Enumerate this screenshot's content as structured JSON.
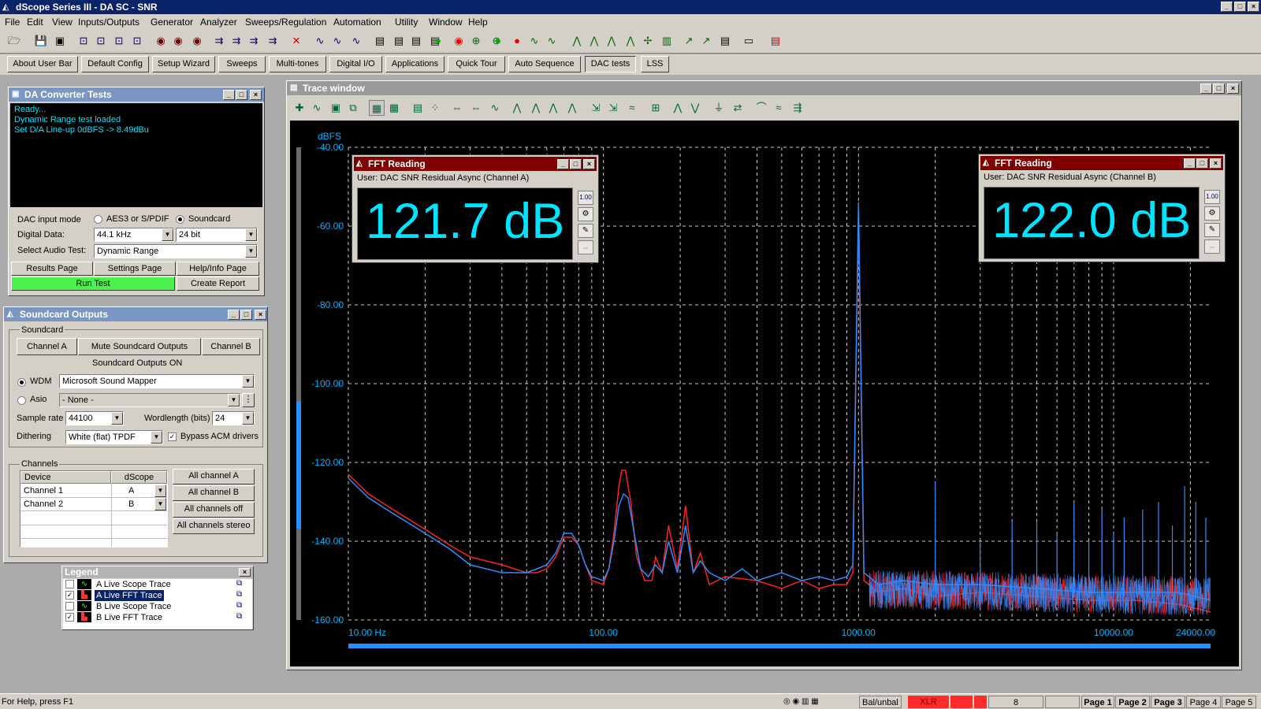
{
  "app": {
    "title": "dScope Series III - DA SC - SNR"
  },
  "menu": [
    "File",
    "Edit",
    "View",
    "Inputs/Outputs",
    "Generator",
    "Analyzer",
    "Sweeps/Regulation",
    "Automation",
    "Utility",
    "Window",
    "Help"
  ],
  "userbar": [
    "About User Bar",
    "Default Config",
    "Setup Wizard",
    "Sweeps",
    "Multi-tones",
    "Digital I/O",
    "Applications",
    "Quick Tour",
    "Auto Sequence",
    "DAC tests",
    "LSS"
  ],
  "da": {
    "title": "DA Converter Tests",
    "log": [
      "Ready...",
      "Dynamic Range test loaded",
      "Set D/A Line-up 0dBFS -> 8.49dBu"
    ],
    "input_mode_label": "DAC input mode",
    "opt_aes": "AES3 or S/PDIF",
    "opt_sc": "Soundcard",
    "digital_data_label": "Digital Data:",
    "rate": "44.1 kHz",
    "bits": "24 bit",
    "audio_test_label": "Select Audio Test:",
    "audio_test": "Dynamic Range",
    "btn_results": "Results Page",
    "btn_settings": "Settings Page",
    "btn_help": "Help/Info Page",
    "btn_run": "Run Test",
    "btn_report": "Create Report"
  },
  "sc": {
    "title": "Soundcard Outputs",
    "group": "Soundcard",
    "btn_a": "Channel A",
    "btn_mute": "Mute Soundcard Outputs",
    "btn_b": "Channel B",
    "status": "Soundcard Outputs ON",
    "wdm": "WDM",
    "wdm_dev": "Microsoft Sound Mapper",
    "asio": "Asio",
    "asio_dev": "- None -",
    "rate_label": "Sample rate",
    "rate": "44100",
    "wl_label": "Wordlength (bits)",
    "wl": "24",
    "dither_label": "Dithering",
    "dither": "White (flat) TPDF",
    "bypass": "Bypass ACM drivers",
    "channels_group": "Channels",
    "col_device": "Device",
    "col_dscope": "dScope",
    "rows": [
      {
        "device": "Channel 1",
        "ch": "A"
      },
      {
        "device": "Channel 2",
        "ch": "B"
      }
    ],
    "btn_all_a": "All channel A",
    "btn_all_b": "All channel B",
    "btn_off": "All channels off",
    "btn_stereo": "All channels stereo"
  },
  "legend": {
    "title": "Legend",
    "items": [
      {
        "label": "A  Live Scope Trace",
        "checked": false,
        "sel": false
      },
      {
        "label": "A  Live FFT Trace",
        "checked": true,
        "sel": true
      },
      {
        "label": "B  Live Scope Trace",
        "checked": false,
        "sel": false
      },
      {
        "label": "B  Live FFT Trace",
        "checked": true,
        "sel": false
      }
    ]
  },
  "trace": {
    "title": "Trace window",
    "yunit": "dBFS"
  },
  "fft_a": {
    "title": "FFT Reading",
    "source": "User: DAC SNR Residual Async (Channel A)",
    "value": "121.7 dB"
  },
  "fft_b": {
    "title": "FFT Reading",
    "source": "User: DAC SNR Residual Async (Channel B)",
    "value": "122.0 dB"
  },
  "status": {
    "help": "For Help, press F1",
    "bal": "Bal/unbal",
    "xlr": "XLR",
    "num": "8",
    "pages": [
      "Page 1",
      "Page 2",
      "Page 3",
      "Page 4",
      "Page 5"
    ]
  },
  "colors": {
    "chA": "#ff2020",
    "chB": "#2d8cff",
    "plotbg": "#000000",
    "axis": "#00b4ff",
    "fftval": "#00e5ff"
  },
  "chart_data": {
    "type": "line",
    "xscale": "log",
    "xlim": [
      10,
      24000
    ],
    "ylim": [
      -160,
      -40
    ],
    "ylabel": "dBFS",
    "xticks": [
      "10.00 Hz",
      "100.00",
      "1000.00",
      "10000.00",
      "24000.00"
    ],
    "yticks": [
      "-40.00",
      "-60.00",
      "-80.00",
      "-100.00",
      "-120.00",
      "-140.00",
      "-160.00"
    ],
    "grid": true,
    "series": [
      {
        "color": "#ff2020",
        "points": [
          [
            10,
            -123
          ],
          [
            12,
            -128
          ],
          [
            15,
            -132
          ],
          [
            20,
            -137
          ],
          [
            25,
            -141
          ],
          [
            30,
            -144
          ],
          [
            40,
            -146
          ],
          [
            50,
            -148
          ],
          [
            55,
            -148
          ],
          [
            60,
            -147
          ],
          [
            65,
            -144
          ],
          [
            70,
            -139
          ],
          [
            75,
            -139
          ],
          [
            80,
            -141
          ],
          [
            85,
            -146
          ],
          [
            90,
            -150
          ],
          [
            100,
            -151
          ],
          [
            105,
            -147
          ],
          [
            110,
            -138
          ],
          [
            115,
            -126
          ],
          [
            118,
            -122
          ],
          [
            122,
            -122
          ],
          [
            128,
            -130
          ],
          [
            135,
            -144
          ],
          [
            145,
            -150
          ],
          [
            155,
            -150
          ],
          [
            160,
            -144
          ],
          [
            170,
            -148
          ],
          [
            180,
            -136
          ],
          [
            195,
            -147
          ],
          [
            210,
            -131
          ],
          [
            225,
            -148
          ],
          [
            240,
            -143
          ],
          [
            260,
            -151
          ],
          [
            300,
            -149
          ],
          [
            400,
            -150
          ],
          [
            500,
            -152
          ],
          [
            600,
            -150
          ],
          [
            700,
            -152
          ],
          [
            800,
            -151
          ],
          [
            900,
            -151
          ],
          [
            950,
            -148
          ],
          [
            1000,
            -57
          ],
          [
            1050,
            -150
          ],
          [
            1200,
            -153
          ],
          [
            1500,
            -152
          ],
          [
            2000,
            -154
          ],
          [
            3000,
            -153
          ],
          [
            5000,
            -154
          ],
          [
            8000,
            -155
          ],
          [
            12000,
            -155
          ],
          [
            18000,
            -156
          ],
          [
            24000,
            -158
          ]
        ]
      },
      {
        "color": "#2d8cff",
        "points": [
          [
            10,
            -124
          ],
          [
            12,
            -129
          ],
          [
            15,
            -133
          ],
          [
            20,
            -138
          ],
          [
            25,
            -142
          ],
          [
            30,
            -146
          ],
          [
            40,
            -148
          ],
          [
            50,
            -148
          ],
          [
            55,
            -147
          ],
          [
            60,
            -146
          ],
          [
            65,
            -143
          ],
          [
            70,
            -138
          ],
          [
            75,
            -138
          ],
          [
            80,
            -141
          ],
          [
            85,
            -146
          ],
          [
            90,
            -149
          ],
          [
            100,
            -150
          ],
          [
            105,
            -147
          ],
          [
            110,
            -140
          ],
          [
            115,
            -131
          ],
          [
            120,
            -128
          ],
          [
            125,
            -129
          ],
          [
            132,
            -138
          ],
          [
            140,
            -147
          ],
          [
            150,
            -149
          ],
          [
            160,
            -146
          ],
          [
            170,
            -148
          ],
          [
            180,
            -140
          ],
          [
            195,
            -148
          ],
          [
            210,
            -136
          ],
          [
            225,
            -148
          ],
          [
            240,
            -145
          ],
          [
            260,
            -148
          ],
          [
            300,
            -150
          ],
          [
            350,
            -147
          ],
          [
            400,
            -150
          ],
          [
            500,
            -148
          ],
          [
            600,
            -150
          ],
          [
            700,
            -149
          ],
          [
            800,
            -150
          ],
          [
            900,
            -149
          ],
          [
            950,
            -146
          ],
          [
            1000,
            -54
          ],
          [
            1050,
            -148
          ],
          [
            1200,
            -151
          ],
          [
            1500,
            -150
          ],
          [
            2000,
            -151
          ],
          [
            3000,
            -151
          ],
          [
            5000,
            -152
          ],
          [
            8000,
            -153
          ],
          [
            12000,
            -153
          ],
          [
            18000,
            -153
          ],
          [
            24000,
            -155
          ]
        ]
      }
    ]
  }
}
